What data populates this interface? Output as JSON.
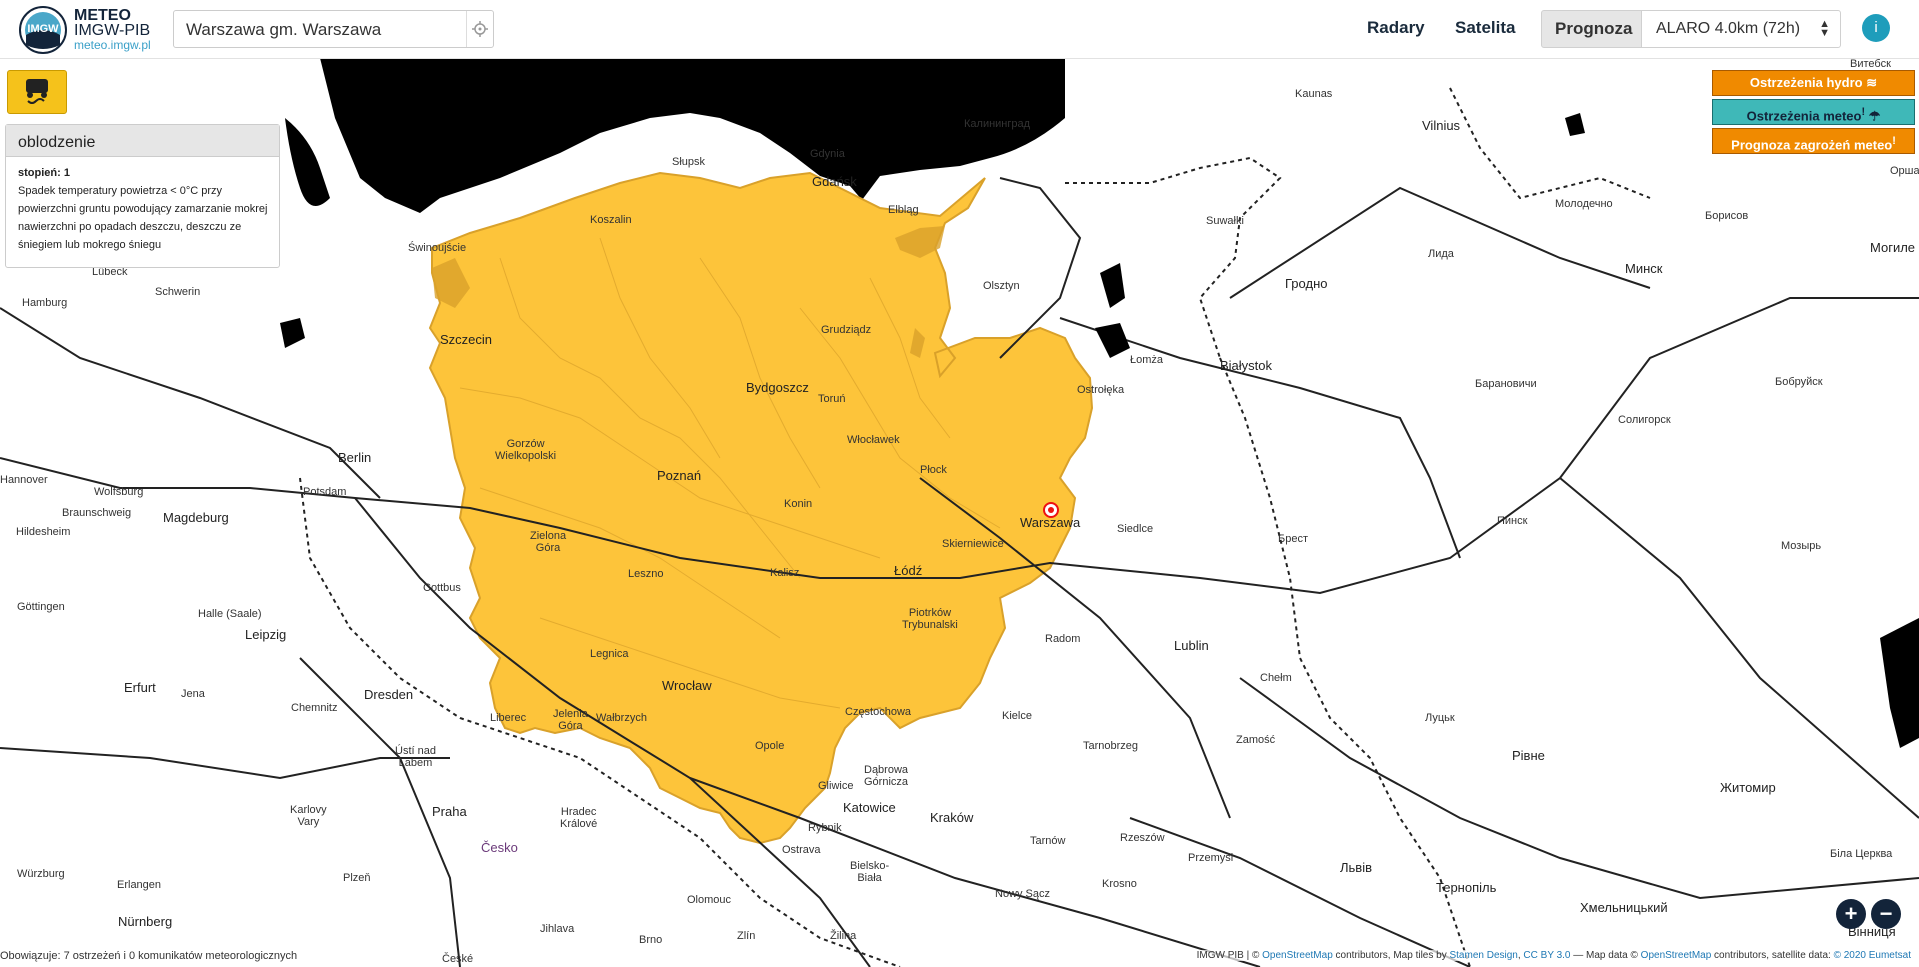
{
  "header": {
    "brand": {
      "line1": "METEO",
      "line2": "IMGW-PIB",
      "url": "meteo.imgw.pl",
      "logo_text": "IMGW"
    },
    "search": {
      "value": "Warszawa gm. Warszawa",
      "locate_icon": "crosshair-icon"
    },
    "nav": {
      "radary": "Radary",
      "satelita": "Satelita",
      "prognoza": "Prognoza"
    },
    "model_select": {
      "value": "ALARO 4.0km (72h)",
      "arrows": "▲▼"
    },
    "info_icon": "i"
  },
  "map_labels": {
    "kaliningrad": "Калининград",
    "vilnius": "Vilnius",
    "vitebsk": "Витебск",
    "kaunas": "Kaunas",
    "molodechno": "Молодечно",
    "borisov": "Борисов",
    "minsk": "Минск",
    "mogilev": "Могиле",
    "orsha": "Орша",
    "suwalki": "Suwałki",
    "lida": "Лида",
    "grodno": "Гродно",
    "bialystok": "Białystok",
    "lomza": "Łomża",
    "baranovichi": "Барановичи",
    "bobruisk": "Бобруйск",
    "soligorsk": "Солигорск",
    "siedlce": "Siedlce",
    "brest": "Брест",
    "pinsk": "Пинск",
    "mozyr": "Мозырь",
    "lublin": "Lublin",
    "chelm": "Chełm",
    "zamosc": "Zamość",
    "lutsk": "Луцьк",
    "rivne": "Рівне",
    "zhytomyr": "Житомир",
    "radom": "Radom",
    "kielce": "Kielce",
    "tarnobrzeg": "Tarnobrzeg",
    "rzeszow": "Rzeszów",
    "przemysl": "Przemyśl",
    "lviv": "Львів",
    "ternopil": "Тернопіль",
    "khmelnytskyi": "Хмельницький",
    "bila_tserkva": "Біла Церква",
    "vinnytsia": "Вінниця",
    "krakow": "Kraków",
    "tarnow": "Tarnów",
    "krosno": "Krosno",
    "nowy_sacz": "Nowy Sącz",
    "zilina": "Žilina",
    "zlin": "Zlín",
    "bielsko": "Bielsko-\nBiała",
    "katowice": "Katowice",
    "gliwice": "Gliwice",
    "dabrowa": "Dąbrowa\nGórnicza",
    "czestochowa": "Częstochowa",
    "rybnik": "Rybnik",
    "ostrava": "Ostrava",
    "olomouc": "Olomouc",
    "brno": "Brno",
    "jihlava": "Jihlava",
    "ceske": "České",
    "cesko": "Česko",
    "praha": "Praha",
    "hradec": "Hradec\nKrálové",
    "plzen": "Plzeň",
    "karlovy": "Karlovy\nVary",
    "usti": "Ústí nad\nLabem",
    "liberec": "Liberec",
    "jelenia": "Jelenia\nGóra",
    "walbrzych": "Wałbrzych",
    "dresden": "Dresden",
    "chemnitz": "Chemnitz",
    "jena": "Jena",
    "erfurt": "Erfurt",
    "leipzig": "Leipzig",
    "halle": "Halle (Saale)",
    "cottbus": "Cottbus",
    "gottingen": "Göttingen",
    "magdeburg": "Magdeburg",
    "braunschweig": "Braunschweig",
    "hildesheim": "Hildesheim",
    "wolfsburg": "Wolfsburg",
    "hannover": "Hannover",
    "berlin": "Berlin",
    "potsdam": "Potsdam",
    "hamburg": "Hamburg",
    "lubeck": "Lübeck",
    "schwerin": "Schwerin",
    "erlangen": "Erlangen",
    "wurzburg": "Würzburg",
    "nurnberg": "Nürnberg",
    "szczecin": "Szczecin",
    "swinoujscie": "Świnoujście",
    "koszalin": "Koszalin",
    "slupsk": "Słupsk",
    "gdynia": "Gdynia",
    "gdansk": "Gdańsk",
    "elblag": "Elbląg",
    "olsztyn": "Olsztyn",
    "grudziadz": "Grudziądz",
    "bydgoszcz": "Bydgoszcz",
    "torun": "Toruń",
    "wloclawek": "Włocławek",
    "plock": "Płock",
    "ostroleka": "Ostrołęka",
    "gorzow": "Gorzów\nWielkopolski",
    "poznan": "Poznań",
    "konin": "Konin",
    "warszawa": "Warszawa",
    "skierniewice": "Skierniewice",
    "zielona": "Zielona\nGóra",
    "leszno": "Leszno",
    "kalisz": "Kalisz",
    "lodz": "Łódź",
    "piotrkow": "Piotrków\nTrybunalski",
    "legnica": "Legnica",
    "wroclaw": "Wrocław",
    "opole": "Opole"
  },
  "warning_panel": {
    "icon": "slippery-road-icon",
    "title": "oblodzenie",
    "level": "stopień: 1",
    "description": "Spadek temperatury powietrza < 0°C przy powierzchni gruntu powodujący zamarzanie mokrej nawierzchni po opadach deszczu, deszczu ze śniegiem lub mokrego śniegu"
  },
  "right_buttons": {
    "hydro": {
      "label": "Ostrzeżenia hydro",
      "icon": "waves-icon",
      "color": "#f08a00"
    },
    "meteo": {
      "label": "Ostrzeżenia meteo",
      "badge": "!",
      "icon": "cloud-rain-icon",
      "color": "#3fb8b8"
    },
    "forecast": {
      "label": "Prognoza zagrożeń meteo",
      "badge": "!",
      "color": "#f08a00"
    }
  },
  "zoom": {
    "in": "+",
    "out": "−"
  },
  "footer": {
    "left": "Obowiązuje: 7 ostrzeżeń i 0 komunikatów meteorologicznych",
    "attr_prefix": "IMGW PIB | © ",
    "osm1": "OpenStreetMap",
    "mid1": " contributors, Map tiles by ",
    "stamen": "Stamen Design",
    "comma": ", ",
    "ccby": "CC BY 3.0",
    "mid2": " — Map data © ",
    "osm2": "OpenStreetMap",
    "mid3": " contributors, satellite data: ",
    "eumetsat": "© 2020 Eumetsat"
  },
  "colors": {
    "warning_fill": "#fdc43a",
    "warning_border": "#d9a12a",
    "sea": "#000000",
    "accent": "#1e9dbb"
  }
}
